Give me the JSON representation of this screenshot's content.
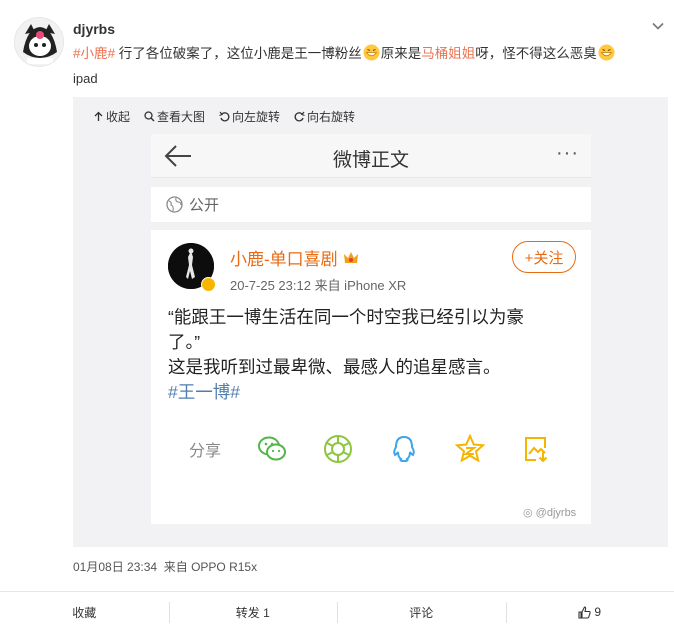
{
  "post": {
    "username": "djyrbs",
    "text": {
      "hashtag": "#小鹿#",
      "part1": " 行了各位破案了，这位小鹿是王一博粉丝",
      "part2": "原来是",
      "link": "马桶姐姐",
      "part3": "呀，怪不得这么恶臭"
    },
    "device_line": "ipad",
    "time": "01月08日 23:34",
    "source": "来自 OPPO R15x"
  },
  "media_toolbar": {
    "collapse": "收起",
    "view_large": "查看大图",
    "rotate_left": "向左旋转",
    "rotate_right": "向右旋转"
  },
  "screenshot": {
    "title": "微博正文",
    "more": "···",
    "visibility": "公开",
    "author_name": "小鹿-单口喜剧",
    "meta": "20-7-25 23:12  来自 iPhone XR",
    "follow_label": "+关注",
    "quote_line1": "“能跟王一博生活在同一个时空我已经引以为豪",
    "quote_line2": "了。”",
    "quote_line3": "这是我听到过最卑微、最感人的追星感言。",
    "topic": "#王一博#",
    "share_label": "分享",
    "share_icons": [
      "wechat-icon",
      "moments-icon",
      "qq-icon",
      "qzone-icon",
      "save-image-icon"
    ],
    "watermark": "@djyrbs"
  },
  "actions": {
    "favorite": "收藏",
    "repost": "转发 1",
    "comment": "评论",
    "like": "9"
  },
  "colors": {
    "hashtag": "#eb7350",
    "follow": "#e86b13",
    "topic": "#507daf",
    "share_green": "#50b64a",
    "share_blue": "#3ea5e8",
    "share_yellow": "#f4b400"
  }
}
